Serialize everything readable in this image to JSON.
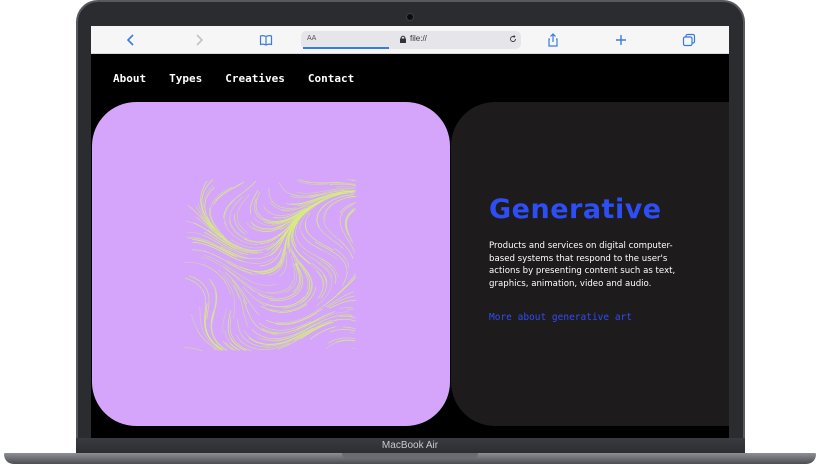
{
  "device": {
    "model_label": "MacBook Air"
  },
  "browser": {
    "address_aa": "AA",
    "url": "file://",
    "icons": [
      "back-icon",
      "forward-icon",
      "bookmarks-icon",
      "lock-icon",
      "reload-icon",
      "share-icon",
      "new-tab-icon",
      "tabs-icon"
    ]
  },
  "nav": {
    "items": [
      {
        "label": "About"
      },
      {
        "label": "Types"
      },
      {
        "label": "Creatives"
      },
      {
        "label": "Contact"
      }
    ]
  },
  "hero": {
    "title": "Generative",
    "description": "Products and services on digital computer-based systems that respond to the user's actions by presenting content such as text, graphics, animation, video and audio.",
    "link": "More about generative art"
  },
  "colors": {
    "art_card_bg": "#d4a5fa",
    "art_lines": "#d6f07a",
    "info_card_bg": "#1e1b1c",
    "accent_blue": "#2d4ef5",
    "page_bg": "#000000"
  }
}
